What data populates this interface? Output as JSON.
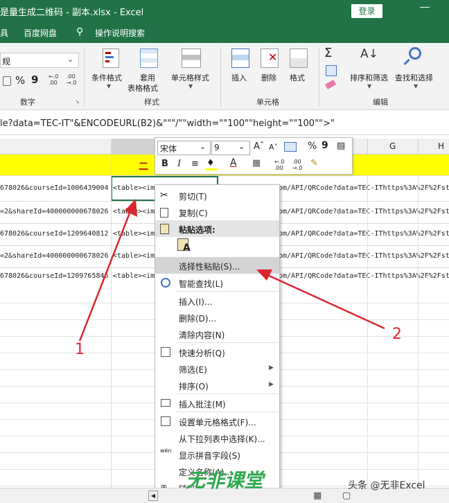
{
  "window": {
    "title": "是量生成二维码 - 副本.xlsx  -  Excel",
    "login_label": "登录"
  },
  "menubar": {
    "items": [
      "具",
      "百度网盘",
      "操作说明搜索"
    ]
  },
  "ribbon": {
    "number_format_value": "规",
    "groups": {
      "number": "数字",
      "styles": "样式",
      "cells": "单元格",
      "editing": "编辑"
    },
    "buttons": {
      "conditional_format": "条件格式",
      "table_format_1": "套用",
      "table_format_2": "表格格式",
      "cell_styles": "单元格样式",
      "insert": "插入",
      "delete": "删除",
      "format": "格式",
      "sort_filter": "排序和筛选",
      "find_select": "查找和选择",
      "percent": "%",
      "comma": "9"
    }
  },
  "formula_bar": {
    "text": "le?data=TEC-IT\"&ENCODEURL(B2)&\"\"\"/\"\"width=\"\"100\"\"height=\"\"100\"\">\""
  },
  "columns": {
    "g": "G",
    "h": "H"
  },
  "rows": [
    {
      "a": "678026&courseId=1006439004",
      "b": "<table><im",
      "c": "om/API/QRCode?data=TEC-IThttps%3A%2F%2Fst"
    },
    {
      "a": "=2&shareId=400000000678026",
      "b": "<table><im",
      "c": "om/API/QRCode?data=TEC-IThttps%3A%2F%2Fst"
    },
    {
      "a": "678026&courseId=1209640812",
      "b": "<table><im",
      "c": "om/API/QRCode?data=TEC-IThttps%3A%2F%2Fst"
    },
    {
      "a": "=2&shareId=400000000678026",
      "b": "<table><im",
      "c": "om/API/QRCode?data=TEC-IThttps%3A%2F%2Fst"
    },
    {
      "a": "678026&courseId=1209765846",
      "b": "<table><im",
      "c": "om/API/QRCode?data=TEC-IThttps%3A%2F%2Fst"
    }
  ],
  "header_cell_text": "二",
  "mini_toolbar": {
    "font_name": "宋体",
    "font_size": "9",
    "percent": "%",
    "comma": "9",
    "bold": "B",
    "italic": "I"
  },
  "context_menu": {
    "items": [
      {
        "label": "剪切(T)",
        "icon": "scissors-icon"
      },
      {
        "label": "复制(C)",
        "icon": "copy-icon"
      },
      {
        "label": "粘贴选项:",
        "icon": "paste-icon"
      },
      {
        "label": "选择性粘贴(S)...",
        "icon": ""
      },
      {
        "label": "智能查找(L)",
        "icon": "smart-lookup-icon"
      },
      {
        "label": "插入(I)...",
        "icon": ""
      },
      {
        "label": "删除(D)...",
        "icon": ""
      },
      {
        "label": "清除内容(N)",
        "icon": ""
      },
      {
        "label": "快速分析(Q)",
        "icon": "quick-analysis-icon"
      },
      {
        "label": "筛选(E)",
        "icon": ""
      },
      {
        "label": "排序(O)",
        "icon": ""
      },
      {
        "label": "插入批注(M)",
        "icon": "comment-icon"
      },
      {
        "label": "设置单元格格式(F)...",
        "icon": "format-cells-icon"
      },
      {
        "label": "从下拉列表中选择(K)...",
        "icon": ""
      },
      {
        "label": "显示拼音字段(S)",
        "icon": "phonetic-icon"
      },
      {
        "label": "定义名称(A)...",
        "icon": ""
      },
      {
        "label": "链接(I)",
        "icon": "link-icon"
      }
    ],
    "paste_option_letter": "A",
    "phonetic_glyph": "wén"
  },
  "annotations": {
    "label_1": "1",
    "label_2": "2",
    "color": "#d9262f"
  },
  "watermark": {
    "logo_text": "无非课堂",
    "byline": "头条 @无非Excel"
  },
  "colors": {
    "excel_green": "#217346",
    "highlight_yellow": "#ffff00",
    "header_text_red": "#c00000"
  }
}
